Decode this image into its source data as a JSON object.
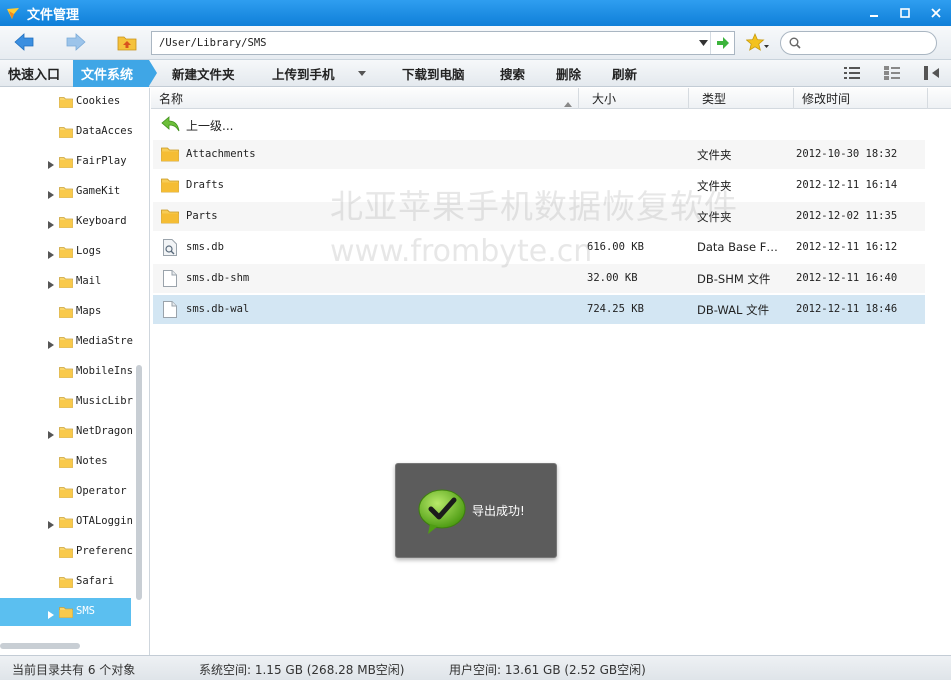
{
  "window": {
    "title": "文件管理"
  },
  "address": {
    "path": "/User/Library/SMS",
    "search_placeholder": ""
  },
  "tabs": {
    "quick": "快速入口",
    "filesystem": "文件系统"
  },
  "toolbar": {
    "new_folder": "新建文件夹",
    "upload": "上传到手机",
    "download": "下载到电脑",
    "search": "搜索",
    "delete": "删除",
    "refresh": "刷新"
  },
  "sidebar": {
    "items": [
      {
        "label": "Cookies",
        "expandable": false
      },
      {
        "label": "DataAcces",
        "expandable": false
      },
      {
        "label": "FairPlay",
        "expandable": true
      },
      {
        "label": "GameKit",
        "expandable": true
      },
      {
        "label": "Keyboard",
        "expandable": true
      },
      {
        "label": "Logs",
        "expandable": true
      },
      {
        "label": "Mail",
        "expandable": true
      },
      {
        "label": "Maps",
        "expandable": false
      },
      {
        "label": "MediaStre",
        "expandable": true
      },
      {
        "label": "MobileIns",
        "expandable": false
      },
      {
        "label": "MusicLibr",
        "expandable": false
      },
      {
        "label": "NetDragon",
        "expandable": true
      },
      {
        "label": "Notes",
        "expandable": false
      },
      {
        "label": "Operator",
        "expandable": false
      },
      {
        "label": "OTALoggin",
        "expandable": true
      },
      {
        "label": "Preferenc",
        "expandable": false
      },
      {
        "label": "Safari",
        "expandable": false
      },
      {
        "label": "SMS",
        "expandable": true,
        "selected": true
      }
    ]
  },
  "columns": {
    "name": "名称",
    "size": "大小",
    "type": "类型",
    "modified": "修改时间"
  },
  "parent_label": "上一级...",
  "files": [
    {
      "name": "Attachments",
      "size": "",
      "type": "文件夹",
      "modified": "2012-10-30 18:32",
      "kind": "folder"
    },
    {
      "name": "Drafts",
      "size": "",
      "type": "文件夹",
      "modified": "2012-12-11 16:14",
      "kind": "folder"
    },
    {
      "name": "Parts",
      "size": "",
      "type": "文件夹",
      "modified": "2012-12-02 11:35",
      "kind": "folder"
    },
    {
      "name": "sms.db",
      "size": "616.00 KB",
      "type": "Data Base F…",
      "modified": "2012-12-11 16:12",
      "kind": "db"
    },
    {
      "name": "sms.db-shm",
      "size": "32.00 KB",
      "type": "DB-SHM 文件",
      "modified": "2012-12-11 16:40",
      "kind": "file"
    },
    {
      "name": "sms.db-wal",
      "size": "724.25 KB",
      "type": "DB-WAL 文件",
      "modified": "2012-12-11 18:46",
      "kind": "file",
      "selected": true
    }
  ],
  "watermark": {
    "line1": "北亚苹果手机数据恢复软件",
    "line2": "www.frombyte.cn"
  },
  "toast": {
    "message": "导出成功!"
  },
  "status": {
    "count": "当前目录共有 6 个对象",
    "system_space": "系统空间: 1.15 GB (268.28 MB空闲)",
    "user_space": "用户空间: 13.61 GB (2.52 GB空闲)"
  },
  "colors": {
    "accent": "#3fa6e6",
    "titlebar": "#1a8ae3",
    "selection": "#d3e6f3"
  }
}
